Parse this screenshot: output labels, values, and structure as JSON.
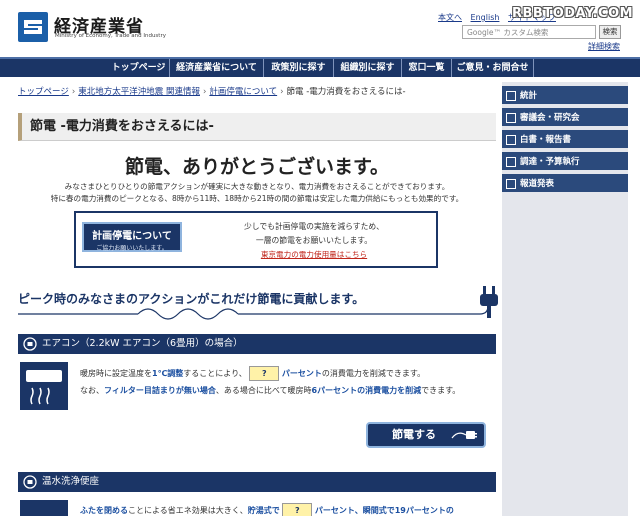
{
  "header": {
    "logo_title": "経済産業省",
    "logo_subtitle": "Ministry of Economy, Trade and Industry",
    "util_links": [
      "本文へ",
      "English",
      "サイトマップ"
    ],
    "watermark": "RBBTODAY.COM",
    "search_placeholder": "Google™ カスタム検索",
    "search_button": "検索",
    "advanced_search": "詳細検索"
  },
  "nav": {
    "items": [
      "トップページ",
      "経済産業省について",
      "政策別に探す",
      "組織別に探す",
      "窓口一覧",
      "ご意見・お問合せ"
    ]
  },
  "breadcrumb": {
    "items": [
      "トップページ",
      "東北地方太平洋沖地震 関連情報",
      "計画停電について",
      "節電 -電力消費をおさえるには-"
    ]
  },
  "main": {
    "page_title": "節電 -電力消費をおさえるには-",
    "headline": "節電、ありがとうございます。",
    "intro_line1": "みなさまひとりひとりの節電アクションが確実に大きな動きとなり、電力消費をおさえることができております。",
    "intro_line2": "特に春の電力消費のピークとなる、8時から11時、18時から21時の間の節電は安定した電力供給にもっとも効果的です。",
    "notice": {
      "button_title": "計画停電について",
      "button_sub": "ご協力お願いいたします。",
      "text1": "少しでも計画停電の実施を減らすため、",
      "text2": "一層の節電をお願いいたします。",
      "link": "東京電力の電力使用量はこちら"
    },
    "peak_title": "ピーク時のみなさまのアクションがこれだけ節電に貢献します。",
    "ac_section": {
      "title": "エアコン（2.2kW エアコン（6畳用）の場合）",
      "line1_a": "暖房時に設定温度を",
      "line1_hl": "1℃調整",
      "line1_b": "することにより、",
      "qmark": "?",
      "line1_c": "パーセント",
      "line1_d": "の消費電力を削減できます。",
      "line2_a": "なお、",
      "line2_hl1": "フィルター目詰まりが無い場合",
      "line2_b": "、ある場合に比べて暖房時",
      "line2_hl2": "6パーセントの消費電力を削減",
      "line2_c": "できます。",
      "save_button": "節電する"
    },
    "washlet_section": {
      "title": "温水洗浄便座",
      "line_hl1": "ふたを閉める",
      "line_a": "ことによる省エネ効果は大きく、",
      "line_hl2": "貯湯式で",
      "qmark": "?",
      "line_hl3": "パーセント、瞬間式で19パーセントの"
    }
  },
  "sidebar": {
    "items": [
      "統計",
      "審議会・研究会",
      "白書・報告書",
      "調達・予算執行",
      "報道発表"
    ]
  },
  "colors": {
    "brand_navy": "#1b3566",
    "link_blue": "#1a3a8a",
    "highlight_blue": "#1b4fa0",
    "link_red": "#c0261b",
    "question_yellow": "#fff2a8"
  }
}
